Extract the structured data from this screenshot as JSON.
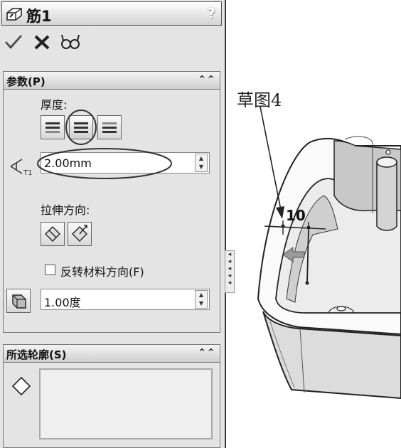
{
  "panel": {
    "title": "筋1",
    "help": "?",
    "actions": {
      "ok": "ok-check",
      "cancel": "cancel-x",
      "preview": "detail-preview"
    }
  },
  "params": {
    "header": "参数(P)",
    "thickness_label": "厚度:",
    "thickness_value": "2.00mm",
    "extrude_dir_label": "拉伸方向:",
    "flip_label": "反转材料方向(F)",
    "flip_checked": false,
    "draft_value": "1.00度"
  },
  "profiles": {
    "header": "所选轮廓(S)"
  },
  "viewport": {
    "sketch_label": "草图4",
    "dimension": "10"
  }
}
